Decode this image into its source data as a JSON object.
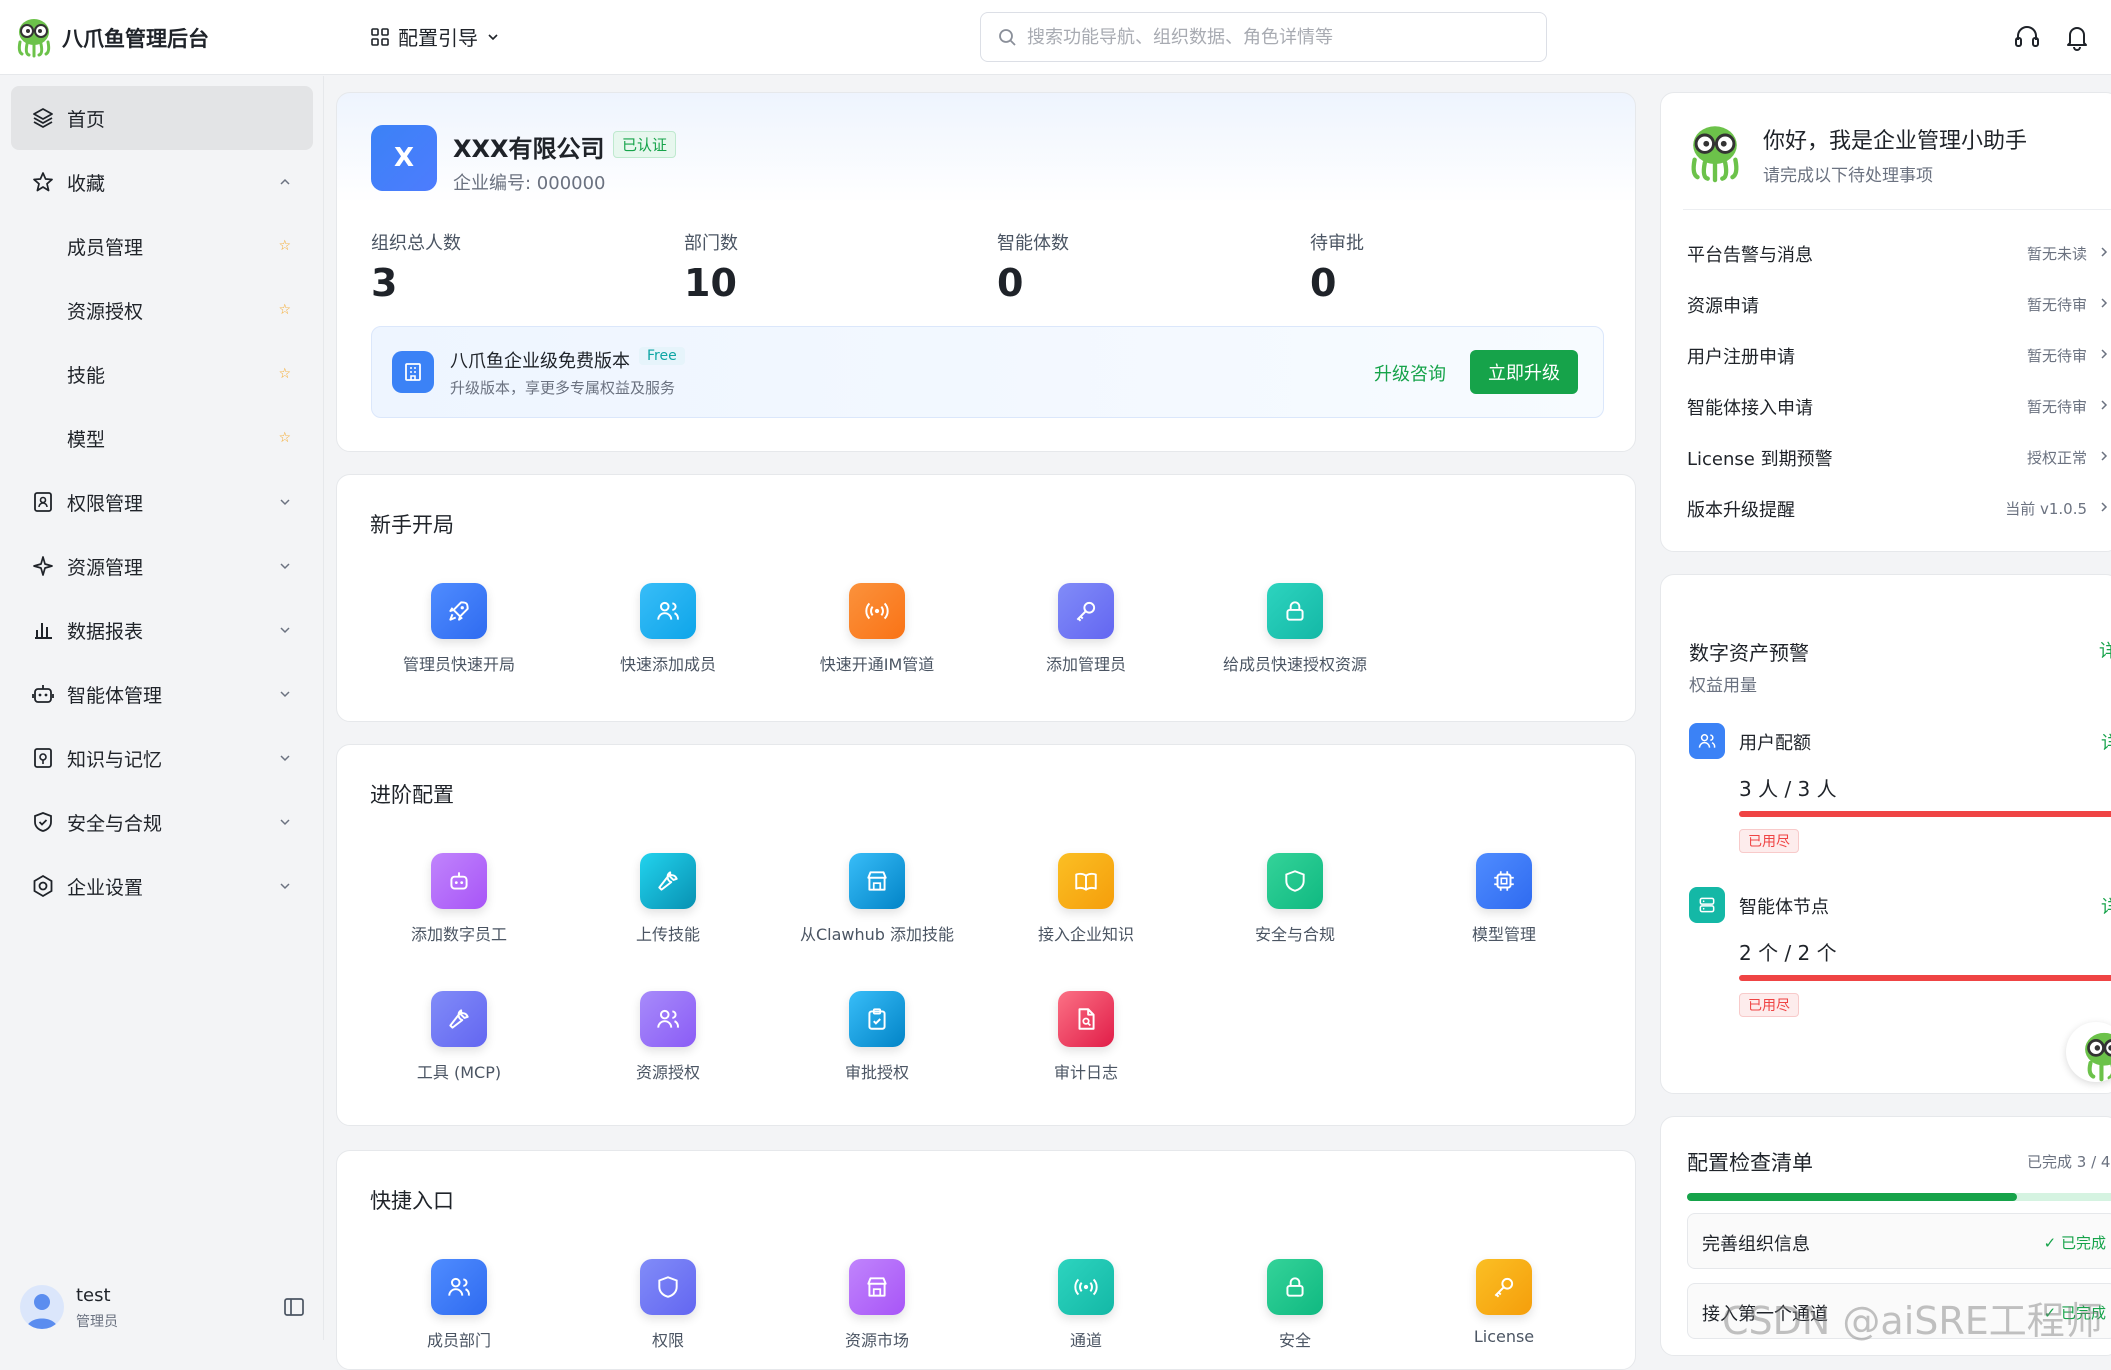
{
  "header": {
    "brand": "八爪鱼管理后台",
    "config_guide": "配置引导",
    "search_placeholder": "搜索功能导航、组织数据、角色详情等"
  },
  "sidebar": {
    "home": "首页",
    "favorites": "收藏",
    "fav_items": [
      "成员管理",
      "资源授权",
      "技能",
      "模型"
    ],
    "items": [
      "权限管理",
      "资源管理",
      "数据报表",
      "智能体管理",
      "知识与记忆",
      "安全与合规",
      "企业设置"
    ]
  },
  "user": {
    "name": "test",
    "role": "管理员"
  },
  "company": {
    "logo_letter": "X",
    "name": "XXX有限公司",
    "verified": "已认证",
    "id_label": "企业编号: 000000"
  },
  "stats": [
    {
      "label": "组织总人数",
      "value": "3"
    },
    {
      "label": "部门数",
      "value": "10"
    },
    {
      "label": "智能体数",
      "value": "0"
    },
    {
      "label": "待审批",
      "value": "0"
    }
  ],
  "banner": {
    "title": "八爪鱼企业级免费版本",
    "badge": "Free",
    "subtitle": "升级版本，享更多专属权益及服务",
    "consult": "升级咨询",
    "upgrade": "立即升级"
  },
  "starter": {
    "title": "新手开局",
    "items": [
      "管理员快速开局",
      "快速添加成员",
      "快速开通IM管道",
      "添加管理员",
      "给成员快速授权资源"
    ]
  },
  "advanced": {
    "title": "进阶配置",
    "items": [
      "添加数字员工",
      "上传技能",
      "从Clawhub 添加技能",
      "接入企业知识",
      "安全与合规",
      "模型管理",
      "工具 (MCP)",
      "资源授权",
      "审批授权",
      "审计日志"
    ]
  },
  "shortcuts": {
    "title": "快捷入口",
    "items": [
      "成员部门",
      "权限",
      "资源市场",
      "通道",
      "安全",
      "License"
    ]
  },
  "assistant": {
    "greeting": "你好，我是企业管理小助手",
    "sub": "请完成以下待处理事项",
    "tasks": [
      {
        "name": "平台告警与消息",
        "status": "暂无未读"
      },
      {
        "name": "资源申请",
        "status": "暂无待审"
      },
      {
        "name": "用户注册申请",
        "status": "暂无待审"
      },
      {
        "name": "智能体接入申请",
        "status": "暂无待审"
      },
      {
        "name": "License 到期预警",
        "status": "授权正常"
      },
      {
        "name": "版本升级提醒",
        "status": "当前 v1.0.5"
      }
    ]
  },
  "assets": {
    "title": "数字资产预警",
    "detail": "详情",
    "subtitle": "权益用量",
    "quotas": [
      {
        "name": "用户配额",
        "detail": "详情",
        "value": "3 人 / 3 人",
        "used_fraction": 1.0,
        "tag": "已用尽"
      },
      {
        "name": "智能体节点",
        "detail": "详情",
        "value": "2 个 / 2 个",
        "used_fraction": 1.0,
        "tag": "已用尽"
      }
    ]
  },
  "checklist": {
    "title": "配置检查清单",
    "progress": "已完成 3 / 4",
    "done_fraction": 0.75,
    "items": [
      {
        "name": "完善组织信息",
        "status": "✓ 已完成"
      },
      {
        "name": "接入第一个通道",
        "status": "✓ 已完成"
      }
    ]
  },
  "watermark": "CSDN @aiSRE工程师",
  "colors": {
    "accent": "#16a34a",
    "primary": "#3b82f6",
    "danger": "#ef4444"
  }
}
